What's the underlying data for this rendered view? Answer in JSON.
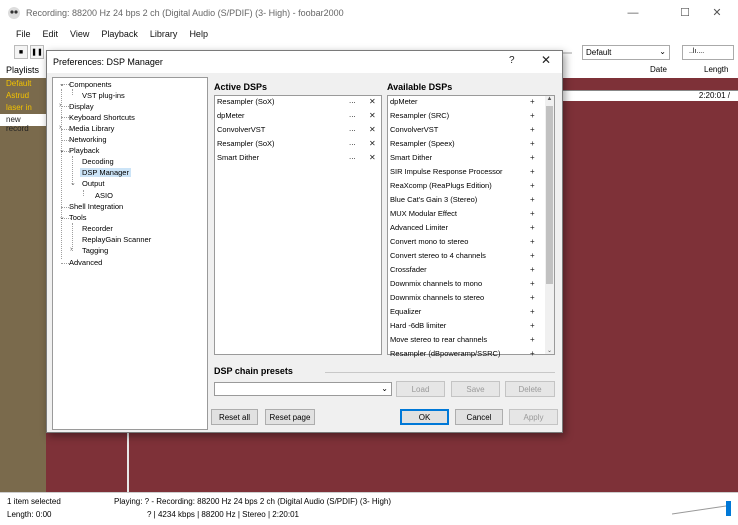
{
  "window": {
    "title": "Recording: 88200 Hz 24 bps 2 ch (Digital Audio (S/PDIF) (3- High) - foobar2000",
    "controls": {
      "minimize": "—",
      "maximize": "☐",
      "close": "✕"
    }
  },
  "menu": [
    "File",
    "Edit",
    "View",
    "Playback",
    "Library",
    "Help"
  ],
  "toolbar": {
    "output_combo": "Default",
    "volume_text": "..lı...."
  },
  "playlists": {
    "header": "Playlists",
    "items": [
      "Default",
      "Astrud",
      "laser in",
      "new record"
    ],
    "columns": {
      "date": "Date",
      "length": "Length"
    },
    "selected_row_length": "2:20:01 /"
  },
  "status": {
    "selection": "1 item selected",
    "length": "Length: 0:00",
    "playing": "Playing:  ? - Recording: 88200 Hz 24 bps 2 ch (Digital Audio (S/PDIF) (3- High)",
    "tech": "? | 4234 kbps | 88200 Hz | Stereo | 2:20:01"
  },
  "dialog": {
    "title": "Preferences: DSP Manager",
    "help": "?",
    "close": "✕",
    "tree": [
      {
        "label": "Components",
        "toggle": "⌄"
      },
      {
        "label": "VST plug-ins"
      },
      {
        "label": "Display",
        "toggle": "›"
      },
      {
        "label": "Keyboard Shortcuts"
      },
      {
        "label": "Media Library",
        "toggle": "›"
      },
      {
        "label": "Networking"
      },
      {
        "label": "Playback",
        "toggle": "⌄"
      },
      {
        "label": "Decoding"
      },
      {
        "label": "DSP Manager"
      },
      {
        "label": "Output",
        "toggle": "⌄"
      },
      {
        "label": "ASIO"
      },
      {
        "label": "Shell Integration"
      },
      {
        "label": "Tools",
        "toggle": "⌄"
      },
      {
        "label": "Recorder"
      },
      {
        "label": "ReplayGain Scanner"
      },
      {
        "label": "Tagging",
        "toggle": "›"
      },
      {
        "label": "Advanced"
      }
    ],
    "active_label": "Active DSPs",
    "available_label": "Available DSPs",
    "active": [
      "Resampler (SoX)",
      "dpMeter",
      "ConvolverVST",
      "Resampler (SoX)",
      "Smart Dither"
    ],
    "available": [
      "dpMeter",
      "Resampler (SRC)",
      "ConvolverVST",
      "Resampler (Speex)",
      "Smart Dither",
      "SIR Impulse Response Processor",
      "ReaXcomp (ReaPlugs Edition)",
      "Blue Cat's Gain 3 (Stereo)",
      "MUX Modular Effect",
      "Advanced Limiter",
      "Convert mono to stereo",
      "Convert stereo to 4 channels",
      "Crossfader",
      "Downmix channels to mono",
      "Downmix channels to stereo",
      "Equalizer",
      "Hard -6dB limiter",
      "Move stereo to rear channels",
      "Resampler (dBpoweramp/SSRC)"
    ],
    "configure_glyph": "...",
    "remove_glyph": "✕",
    "add_glyph": "+",
    "presets_label": "DSP chain presets",
    "buttons": {
      "load": "Load",
      "save": "Save",
      "delete": "Delete",
      "reset_all": "Reset all",
      "reset_page": "Reset page",
      "ok": "OK",
      "cancel": "Cancel",
      "apply": "Apply"
    }
  }
}
